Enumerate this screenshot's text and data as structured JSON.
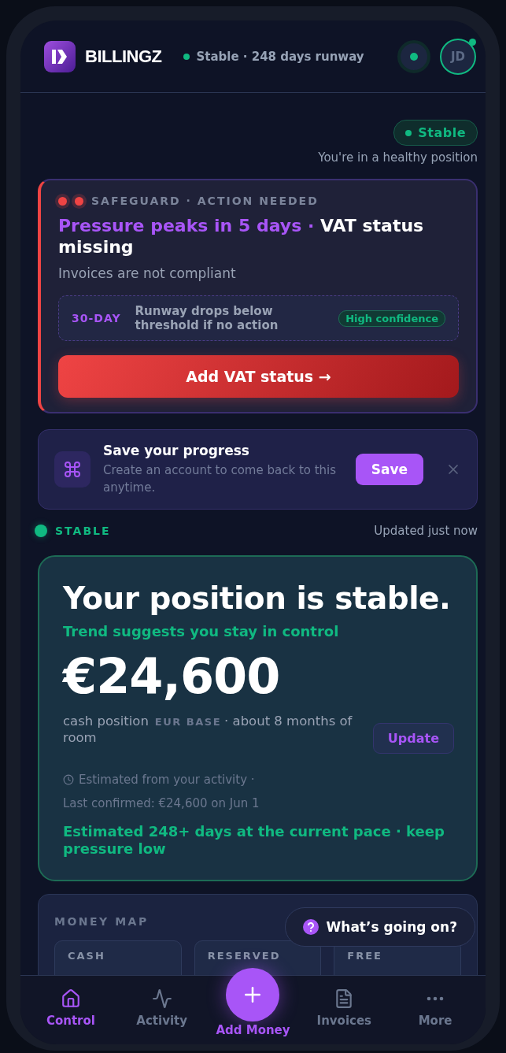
{
  "header": {
    "brand": "BILLINGZ",
    "status": {
      "text": "Stable · 248 days runway",
      "color": "#10b981"
    },
    "avatar": {
      "initials": "JD",
      "online": true
    }
  },
  "health": {
    "badge": "Stable",
    "caption": "You're in a healthy position"
  },
  "alert": {
    "eyebrow": "SAFEGUARD · ACTION NEEDED",
    "title_highlight": "Pressure peaks in 5 days · ",
    "title_rest": "VAT status missing",
    "subtitle": "Invoices are not compliant",
    "forecast": {
      "period": "30-DAY",
      "text": "Runway drops below threshold if no action",
      "confidence": "High confidence"
    },
    "action": "Add VAT status →"
  },
  "save_prompt": {
    "title": "Save your progress",
    "text": "Create an account to come back to this anytime.",
    "button": "Save"
  },
  "status_row": {
    "label": "STABLE",
    "updated": "Updated just now"
  },
  "position": {
    "headline": "Your position is stable.",
    "trend": "Trend suggests you stay in control",
    "amount": "€24,600",
    "caption_start": "cash position",
    "currency_tag": "EUR BASE",
    "caption_end": "· about 8 months of room",
    "update_button": "Update",
    "estimate_note": "Estimated from your activity  ·",
    "last_confirmed": "Last confirmed: €24,600 on Jun 1",
    "runway_note": "Estimated 248+ days at the current pace · keep pressure low"
  },
  "money_map": {
    "title": "MONEY MAP",
    "tiles": [
      {
        "label": "CASH"
      },
      {
        "label": "RESERVED"
      },
      {
        "label": "FREE"
      }
    ]
  },
  "help_button": {
    "label": "What’s going on?"
  },
  "nav": {
    "items": [
      {
        "kind": "tab",
        "label": "Control",
        "selected": true
      },
      {
        "kind": "tab",
        "label": "Activity",
        "selected": false
      },
      {
        "kind": "fab",
        "label": "Add Money",
        "selected": false
      },
      {
        "kind": "tab",
        "label": "Invoices",
        "selected": false
      },
      {
        "kind": "tab",
        "label": "More",
        "selected": false
      }
    ]
  }
}
